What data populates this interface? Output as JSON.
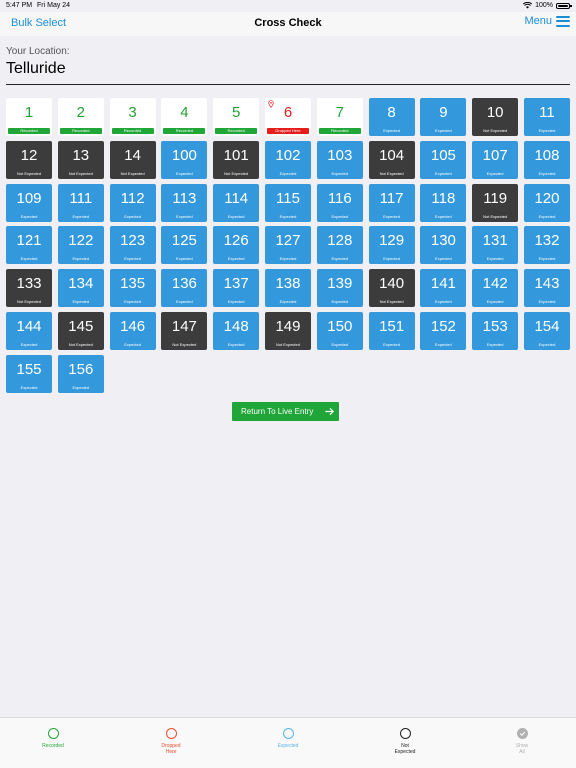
{
  "status": {
    "time": "5:47 PM",
    "date": "Fri May 24",
    "battery": "100%"
  },
  "nav": {
    "left": "Bulk Select",
    "title": "Cross Check",
    "menu": "Menu"
  },
  "location": {
    "label": "Your Location:",
    "value": "Telluride"
  },
  "tiles": [
    {
      "n": "1",
      "s": "Recorded",
      "k": "recorded"
    },
    {
      "n": "2",
      "s": "Recorded",
      "k": "recorded"
    },
    {
      "n": "3",
      "s": "Recorded",
      "k": "recorded"
    },
    {
      "n": "4",
      "s": "Recorded",
      "k": "recorded"
    },
    {
      "n": "5",
      "s": "Recorded",
      "k": "recorded"
    },
    {
      "n": "6",
      "s": "Dropped Here",
      "k": "dropped"
    },
    {
      "n": "7",
      "s": "Recorded",
      "k": "recorded"
    },
    {
      "n": "8",
      "s": "Expected",
      "k": "expected"
    },
    {
      "n": "9",
      "s": "Expected",
      "k": "expected"
    },
    {
      "n": "10",
      "s": "Not Expected",
      "k": "notexp"
    },
    {
      "n": "11",
      "s": "Expected",
      "k": "expected"
    },
    {
      "n": "12",
      "s": "Not Expected",
      "k": "notexp"
    },
    {
      "n": "13",
      "s": "Not Expected",
      "k": "notexp"
    },
    {
      "n": "14",
      "s": "Not Expected",
      "k": "notexp"
    },
    {
      "n": "100",
      "s": "Expected",
      "k": "expected"
    },
    {
      "n": "101",
      "s": "Not Expected",
      "k": "notexp"
    },
    {
      "n": "102",
      "s": "Expected",
      "k": "expected"
    },
    {
      "n": "103",
      "s": "Expected",
      "k": "expected"
    },
    {
      "n": "104",
      "s": "Not Expected",
      "k": "notexp"
    },
    {
      "n": "105",
      "s": "Expected",
      "k": "expected"
    },
    {
      "n": "107",
      "s": "Expected",
      "k": "expected"
    },
    {
      "n": "108",
      "s": "Expected",
      "k": "expected"
    },
    {
      "n": "109",
      "s": "Expected",
      "k": "expected"
    },
    {
      "n": "111",
      "s": "Expected",
      "k": "expected"
    },
    {
      "n": "112",
      "s": "Expected",
      "k": "expected"
    },
    {
      "n": "113",
      "s": "Expected",
      "k": "expected"
    },
    {
      "n": "114",
      "s": "Expected",
      "k": "expected"
    },
    {
      "n": "115",
      "s": "Expected",
      "k": "expected"
    },
    {
      "n": "116",
      "s": "Expected",
      "k": "expected"
    },
    {
      "n": "117",
      "s": "Expected",
      "k": "expected"
    },
    {
      "n": "118",
      "s": "Expected",
      "k": "expected"
    },
    {
      "n": "119",
      "s": "Not Expected",
      "k": "notexp"
    },
    {
      "n": "120",
      "s": "Expected",
      "k": "expected"
    },
    {
      "n": "121",
      "s": "Expected",
      "k": "expected"
    },
    {
      "n": "122",
      "s": "Expected",
      "k": "expected"
    },
    {
      "n": "123",
      "s": "Expected",
      "k": "expected"
    },
    {
      "n": "125",
      "s": "Expected",
      "k": "expected"
    },
    {
      "n": "126",
      "s": "Expected",
      "k": "expected"
    },
    {
      "n": "127",
      "s": "Expected",
      "k": "expected"
    },
    {
      "n": "128",
      "s": "Expected",
      "k": "expected"
    },
    {
      "n": "129",
      "s": "Expected",
      "k": "expected"
    },
    {
      "n": "130",
      "s": "Expected",
      "k": "expected"
    },
    {
      "n": "131",
      "s": "Expected",
      "k": "expected"
    },
    {
      "n": "132",
      "s": "Expected",
      "k": "expected"
    },
    {
      "n": "133",
      "s": "Not Expected",
      "k": "notexp"
    },
    {
      "n": "134",
      "s": "Expected",
      "k": "expected"
    },
    {
      "n": "135",
      "s": "Expected",
      "k": "expected"
    },
    {
      "n": "136",
      "s": "Expected",
      "k": "expected"
    },
    {
      "n": "137",
      "s": "Expected",
      "k": "expected"
    },
    {
      "n": "138",
      "s": "Expected",
      "k": "expected"
    },
    {
      "n": "139",
      "s": "Expected",
      "k": "expected"
    },
    {
      "n": "140",
      "s": "Not Expected",
      "k": "notexp"
    },
    {
      "n": "141",
      "s": "Expected",
      "k": "expected"
    },
    {
      "n": "142",
      "s": "Expected",
      "k": "expected"
    },
    {
      "n": "143",
      "s": "Expected",
      "k": "expected"
    },
    {
      "n": "144",
      "s": "Expected",
      "k": "expected"
    },
    {
      "n": "145",
      "s": "Not Expected",
      "k": "notexp"
    },
    {
      "n": "146",
      "s": "Expected",
      "k": "expected"
    },
    {
      "n": "147",
      "s": "Not Expected",
      "k": "notexp"
    },
    {
      "n": "148",
      "s": "Expected",
      "k": "expected"
    },
    {
      "n": "149",
      "s": "Not Expected",
      "k": "notexp"
    },
    {
      "n": "150",
      "s": "Expected",
      "k": "expected"
    },
    {
      "n": "151",
      "s": "Expected",
      "k": "expected"
    },
    {
      "n": "152",
      "s": "Expected",
      "k": "expected"
    },
    {
      "n": "153",
      "s": "Expected",
      "k": "expected"
    },
    {
      "n": "154",
      "s": "Expected",
      "k": "expected"
    },
    {
      "n": "155",
      "s": "Expected",
      "k": "expected"
    },
    {
      "n": "156",
      "s": "Expected",
      "k": "expected"
    }
  ],
  "button": {
    "label": "Return To Live Entry",
    "icon": "arrow-right-icon"
  },
  "tabs": [
    {
      "label": "Recorded",
      "color": "#21a638",
      "icon": "recorded-circle-icon"
    },
    {
      "label": "Dropped\nHere",
      "color": "#e8502f",
      "icon": "dropped-circle-icon"
    },
    {
      "label": "Expected",
      "color": "#5bb3e6",
      "icon": "expected-circle-icon"
    },
    {
      "label": "Not\nExpected",
      "color": "#222222",
      "icon": "not-expected-circle-icon"
    },
    {
      "label": "Show\nAll",
      "color": "#b0b0b0",
      "icon": "check-circle-icon"
    }
  ],
  "colors": {
    "accent": "#1b8ed6",
    "recorded": "#21a638",
    "dropped": "#e61d1d",
    "expected": "#3499dc",
    "not_expected": "#3c3c3c"
  }
}
